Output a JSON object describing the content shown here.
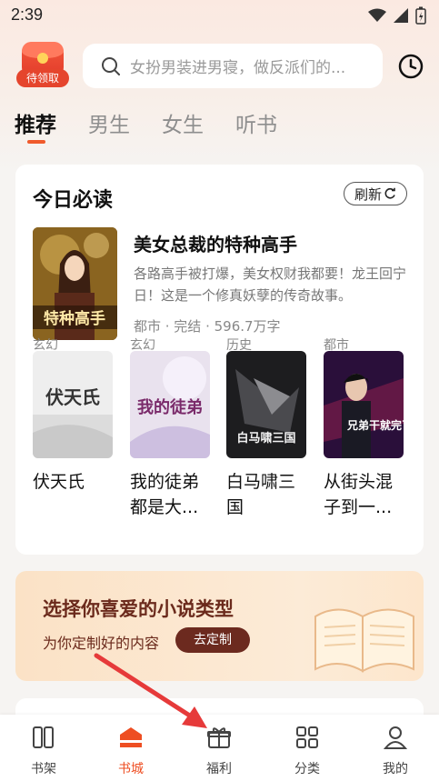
{
  "status_bar": {
    "time": "2:39"
  },
  "header": {
    "gift_label": "待领取",
    "search_placeholder": "女扮男装进男寝，做反派们的..."
  },
  "tabs": [
    {
      "label": "推荐",
      "active": true
    },
    {
      "label": "男生",
      "active": false
    },
    {
      "label": "女生",
      "active": false
    },
    {
      "label": "听书",
      "active": false
    }
  ],
  "today_card": {
    "title": "今日必读",
    "refresh_label": "刷新",
    "featured": {
      "cover_text": "特种高手",
      "title": "美女总裁的特种高手",
      "description": "各路高手被打爆，美女权财我都要！龙王回宁日！这是一个修真妖孽的传奇故事。",
      "meta": "都市 · 完结 · 596.7万字"
    },
    "books": [
      {
        "title": "伏天氏",
        "category": "玄幻",
        "cover_text": "伏天氏"
      },
      {
        "title": "我的徒弟都是大...",
        "category": "玄幻",
        "cover_text": "我的徒弟"
      },
      {
        "title": "白马啸三国",
        "category": "历史",
        "cover_text": "白马啸三国"
      },
      {
        "title": "从街头混子到一...",
        "category": "都市",
        "cover_text": "兄弟干就完了"
      }
    ]
  },
  "promo": {
    "title": "选择你喜爱的小说类型",
    "subtitle": "为你定制好的内容",
    "button": "去定制"
  },
  "bottom_nav": [
    {
      "label": "书架",
      "icon": "bookshelf-icon",
      "active": false
    },
    {
      "label": "书城",
      "icon": "bookstore-icon",
      "active": true
    },
    {
      "label": "福利",
      "icon": "gift-icon",
      "active": false
    },
    {
      "label": "分类",
      "icon": "grid-icon",
      "active": false
    },
    {
      "label": "我的",
      "icon": "user-icon",
      "active": false
    }
  ],
  "colors": {
    "accent": "#ee4e22",
    "promo_text": "#6b2a1c",
    "arrow": "#e63a3a"
  }
}
